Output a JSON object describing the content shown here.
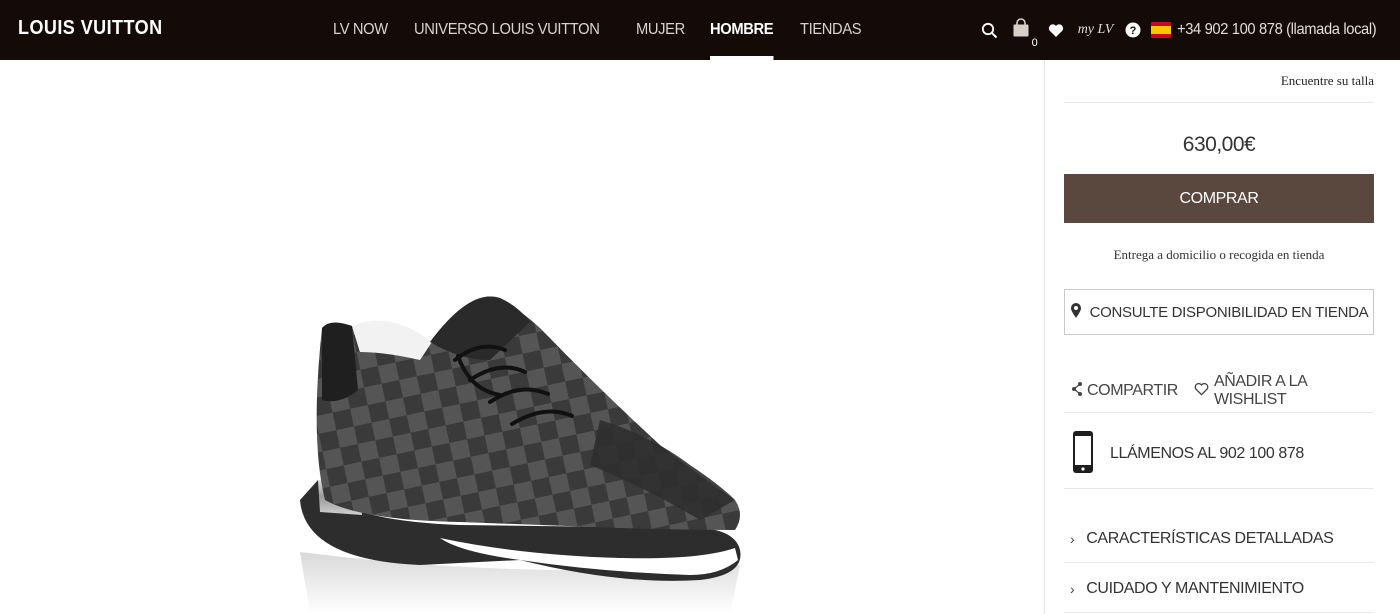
{
  "header": {
    "logo": "LOUIS VUITTON",
    "nav": [
      {
        "label": "LV NOW",
        "active": false
      },
      {
        "label": "UNIVERSO LOUIS VUITTON",
        "active": false
      },
      {
        "label": "MUJER",
        "active": false
      },
      {
        "label": "HOMBRE",
        "active": true
      },
      {
        "label": "TIENDAS",
        "active": false
      }
    ],
    "icons": [
      "search-icon",
      "bag-icon",
      "heart-icon",
      "my-lv-icon",
      "help-icon",
      "spain-flag-icon"
    ],
    "bag_count": "0",
    "my_lv": "my LV",
    "phone": "+34 902 100 878 (llamada local)"
  },
  "product": {
    "image": "sneaker-image",
    "size_link": "Encuentre su talla",
    "price": "630,00€",
    "buy_label": "COMPRAR",
    "delivery_note": "Entrega a domicilio o recogida en tienda",
    "availability_label": "CONSULTE DISPONIBILIDAD EN TIENDA",
    "share_label": "COMPARTIR",
    "wishlist_label": "AÑADIR A LA WISHLIST",
    "call_label": "LLÁMENOS AL 902 100 878",
    "accordion": [
      {
        "label": "CARACTERÍSTICAS DETALLADAS"
      },
      {
        "label": "CUIDADO Y MANTENIMIENTO"
      }
    ]
  },
  "colors": {
    "header_bg": "#140a08",
    "buy_button_bg": "#5a473d"
  }
}
